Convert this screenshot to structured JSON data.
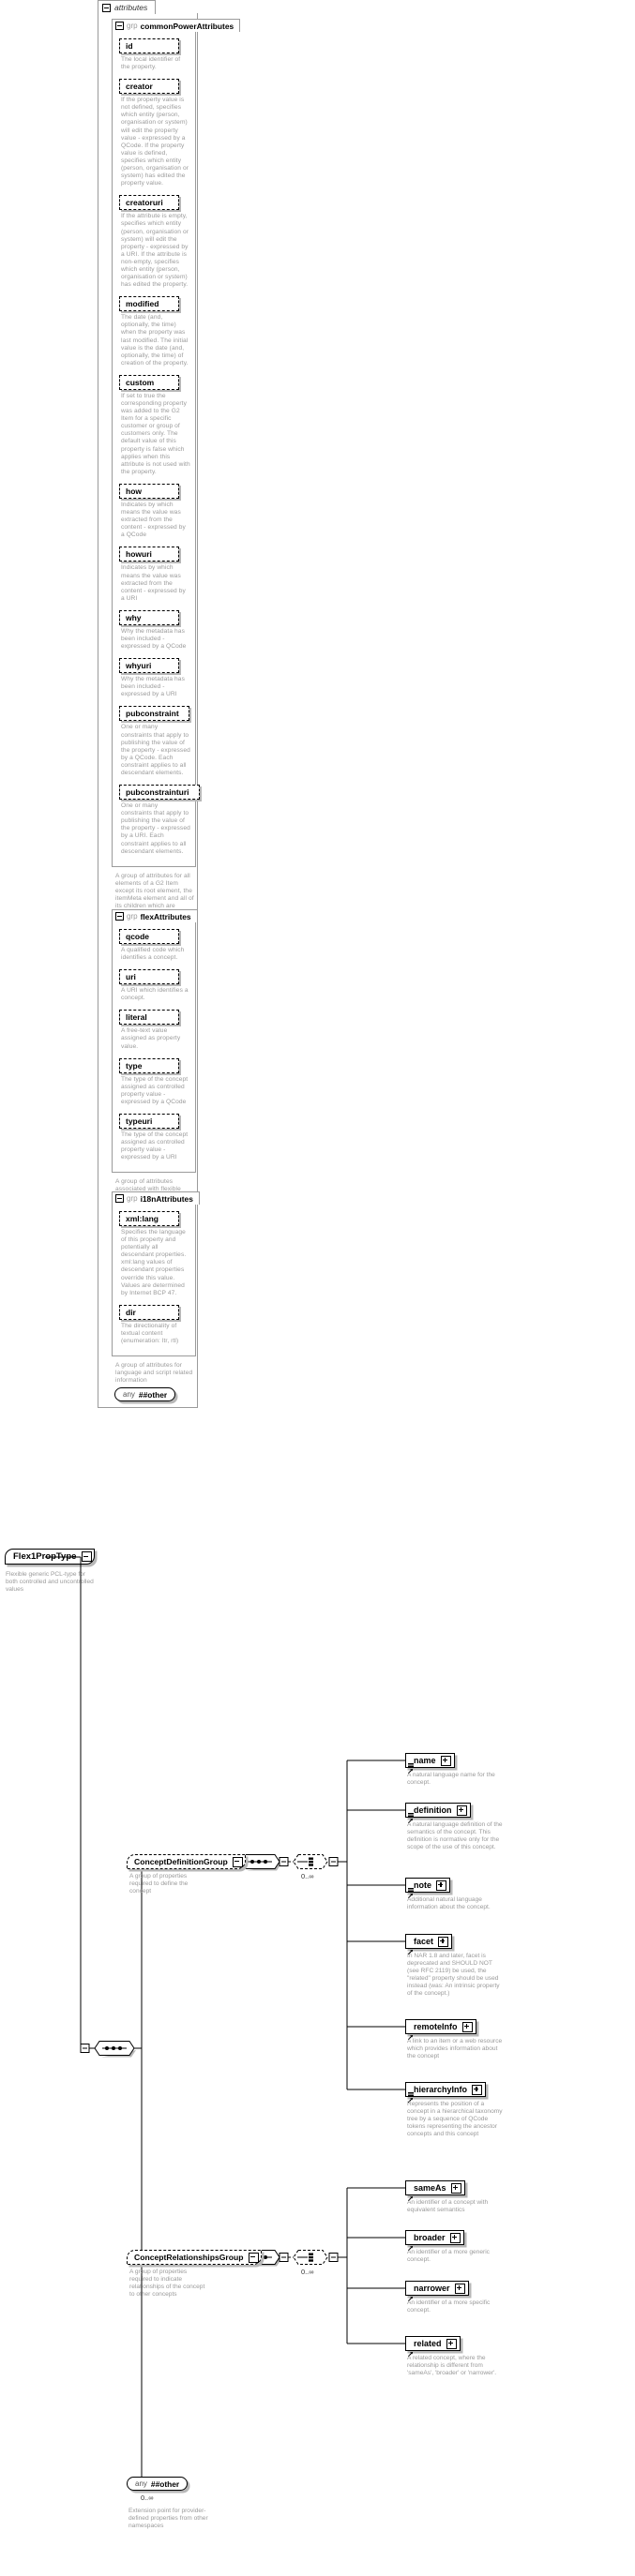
{
  "type_box": {
    "name": "Flex1PropType",
    "description": "Flexible generic PCL-type for both controlled and uncontrolled values"
  },
  "attributes_panel": {
    "label": "attributes",
    "groups": [
      {
        "kind_label": "grp",
        "name": "commonPowerAttributes",
        "footer": "A group of attributes for all elements of a G2 Item except its root element, the itemMeta element and all of its children which are mandatory.",
        "attributes": [
          {
            "name": "id",
            "desc": "The local identifier of the property."
          },
          {
            "name": "creator",
            "desc": "If the property value is not defined, specifies which entity (person, organisation or system) will edit the property value - expressed by a QCode. If the property value is defined, specifies which entity (person, organisation or system) has edited the property value."
          },
          {
            "name": "creatoruri",
            "desc": "If the attribute is empty, specifies which entity (person, organisation or system) will edit the property - expressed by a URI. If the attribute is non-empty, specifies which entity (person, organisation or system) has edited the property."
          },
          {
            "name": "modified",
            "desc": "The date (and, optionally, the time) when the property was last modified. The initial value is the date (and, optionally, the time) of creation of the property."
          },
          {
            "name": "custom",
            "desc": "If set to true the corresponding property was added to the G2 Item for a specific customer or group of customers only. The default value of this property is false which applies when this attribute is not used with the property."
          },
          {
            "name": "how",
            "desc": "Indicates by which means the value was extracted from the content - expressed by a QCode"
          },
          {
            "name": "howuri",
            "desc": "Indicates by which means the value was extracted from the content - expressed by a URI"
          },
          {
            "name": "why",
            "desc": "Why the metadata has been included - expressed by a QCode"
          },
          {
            "name": "whyuri",
            "desc": "Why the metadata has been included - expressed by a URI"
          },
          {
            "name": "pubconstraint",
            "desc": "One or many constraints that apply to publishing the value of the property - expressed by a QCode. Each constraint applies to all descendant elements."
          },
          {
            "name": "pubconstrainturi",
            "desc": "One or many constraints that apply to publishing the value of the property - expressed by a URI. Each constraint applies to all descendant elements."
          }
        ]
      },
      {
        "kind_label": "grp",
        "name": "flexAttributes",
        "footer": "A group of attributes associated with flexible properties",
        "attributes": [
          {
            "name": "qcode",
            "desc": "A qualified code which identifies a concept."
          },
          {
            "name": "uri",
            "desc": "A URI which identifies a concept."
          },
          {
            "name": "literal",
            "desc": "A free-text value assigned as property value."
          },
          {
            "name": "type",
            "desc": "The type of the concept assigned as controlled property value - expressed by a QCode"
          },
          {
            "name": "typeuri",
            "desc": "The type of the concept assigned as controlled property value - expressed by a URI"
          }
        ]
      },
      {
        "kind_label": "grp",
        "name": "i18nAttributes",
        "footer": "A group of attributes for language and script related information",
        "attributes": [
          {
            "name": "xml:lang",
            "desc": "Specifies the language of this property and potentially all descendant properties. xml:lang values of descendant properties override this value. Values are determined by Internet BCP 47."
          },
          {
            "name": "dir",
            "desc": "The directionality of textual content (enumeration: ltr, rtl)"
          }
        ]
      }
    ],
    "any_attr": {
      "prefix": "any",
      "name": "##other"
    }
  },
  "content_model": {
    "root_sequence_symbol": "sequence",
    "groups": [
      {
        "name": "ConceptDefinitionGroup",
        "desc": "A group of properties required to define the concept",
        "multiplicity": "0..∞",
        "elements": [
          {
            "name": "name",
            "desc": "A natural language name for the concept.",
            "icons": [
              "lines",
              "arrow"
            ],
            "expandable": true
          },
          {
            "name": "definition",
            "desc": "A natural language definition of the semantics of the concept. This definition is normative only for the scope of the use of this concept.",
            "icons": [
              "lines",
              "arrow"
            ],
            "expandable": true
          },
          {
            "name": "note",
            "desc": "Additional natural language information about the concept.",
            "icons": [
              "lines",
              "arrow"
            ],
            "expandable": true
          },
          {
            "name": "facet",
            "desc": "In NAR 1.8 and later, facet is deprecated and SHOULD NOT (see RFC 2119) be used, the \"related\" property should be used instead (was: An intrinsic property of the concept.)",
            "icons": [
              "arrow"
            ],
            "expandable": true
          },
          {
            "name": "remoteInfo",
            "desc": "A link to an item or a web resource which provides information about the concept",
            "icons": [
              "arrow"
            ],
            "expandable": true
          },
          {
            "name": "hierarchyInfo",
            "desc": "Represents the position of a concept in a hierarchical taxonomy tree by a sequence of QCode tokens representing the ancestor concepts and this concept",
            "icons": [
              "lines",
              "arrow"
            ],
            "expandable": true
          }
        ]
      },
      {
        "name": "ConceptRelationshipsGroup",
        "desc": "A group of properties required to indicate relationships of the concept to other concepts",
        "multiplicity": "0..∞",
        "elements": [
          {
            "name": "sameAs",
            "desc": "An identifier of a concept with equivalent semantics",
            "icons": [
              "arrow"
            ],
            "expandable": true
          },
          {
            "name": "broader",
            "desc": "An identifier of a more generic concept.",
            "icons": [
              "arrow"
            ],
            "expandable": true
          },
          {
            "name": "narrower",
            "desc": "An identifier of a more specific concept.",
            "icons": [
              "arrow"
            ],
            "expandable": true
          },
          {
            "name": "related",
            "desc": "A related concept, where the relationship is different from 'sameAs', 'broader' or 'narrower'.",
            "icons": [
              "arrow"
            ],
            "expandable": true
          }
        ]
      }
    ],
    "any_element": {
      "prefix": "any",
      "name": "##other",
      "multiplicity": "0..∞",
      "desc": "Extension point for provider-defined properties from other namespaces"
    }
  }
}
